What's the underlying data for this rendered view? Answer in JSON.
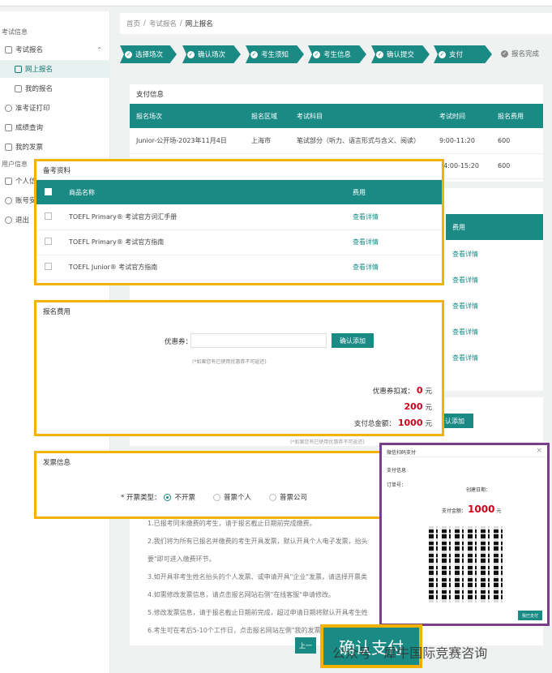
{
  "sidebar": {
    "group_exam": "考试信息",
    "exam_register": "考试报名",
    "online_register": "网上报名",
    "my_register": "我的报名",
    "admission_print": "准考证打印",
    "score_query": "成绩查询",
    "my_invoice": "我的发票",
    "group_user": "用户信息",
    "personal_info": "个人信",
    "account": "账号安",
    "logout": "退出"
  },
  "breadcrumb": {
    "home": "首页",
    "sep": "/",
    "exam_register": "考试报名",
    "current": "网上报名"
  },
  "steps": [
    "选择场次",
    "确认场次",
    "考生须知",
    "考生信息",
    "确认提交",
    "支付"
  ],
  "step_last": "报名完成",
  "check_mark": "✓",
  "payment_info": {
    "title": "支付信息",
    "headers": [
      "报名场次",
      "报名区域",
      "考试科目",
      "考试时间",
      "报名费用"
    ],
    "rows": [
      [
        "Junior-公开场-2023年11月4日",
        "上海市",
        "笔试部分（听力、语言形式与含义、阅读）",
        "9:00-11:20",
        "600"
      ],
      [
        "",
        "",
        "",
        "14:00-15:20",
        "600"
      ]
    ]
  },
  "materials": {
    "title": "备考资料",
    "headers": [
      "商品名称",
      "费用"
    ],
    "rows": [
      {
        "name": "TOEFL Primary® 考试官方词汇手册",
        "action": "查看详情"
      },
      {
        "name": "TOEFL Primary® 考试官方指南",
        "action": "查看详情"
      },
      {
        "name": "TOEFL Junior® 考试官方指南",
        "action": "查看详情"
      }
    ]
  },
  "behind_table": {
    "header": "费用",
    "links": [
      "查看详情",
      "查看详情",
      "查看详情",
      "查看详情",
      "查看详情"
    ],
    "add_btn": "认添加",
    "note": "(*如果您有已使用优惠券不可返还)"
  },
  "fees": {
    "title": "报名费用",
    "coupon_label": "优惠券：",
    "coupon_value": "",
    "add_button": "确认添加",
    "note": "(*如果您有已使用优惠券不可返还)",
    "discount_label": "优惠券扣减：",
    "discount_value": "0",
    "unit": "元",
    "material_value": "200",
    "total_label": "支付总金额：",
    "total_value": "1000"
  },
  "invoice": {
    "title": "发票信息",
    "type_label": "* 开票类型：",
    "options": [
      "不开票",
      "普票个人",
      "普票公司"
    ]
  },
  "notes": [
    "1.已报考同未缴费的考生，请于报名截止日期前完成缴费。",
    "2.我们将为所有已报名并缴费的考生开具发票，默认开具个人电子发票，抬头",
    "要\"即可进入缴费环节。",
    "3.如开具非考生姓名抬头的个人发票、或申请开具\"企业\"发票，请选择开票类",
    "4.如需修改发票信息，请点击报名网站右侧\"在线客服\"申请修改。",
    "5.修改发票信息，请于报名截止日期前完成，超过申请日期将默认开具考生姓",
    "6.考生可在考后5-10个工作日，点击报名网站左侧\"我的发票\"中下载发票。"
  ],
  "pay_dialog": {
    "title": "微信扫码支付",
    "close": "×",
    "section": "支付信息",
    "order_label": "订单号：",
    "order_value": "",
    "date_label": "创建日期：",
    "date_value": "",
    "amount_label": "支付金额：",
    "amount_value": "1000",
    "unit": "元",
    "done_button": "我已支付"
  },
  "confirm_pay": "确认支付",
  "prev_button": "上一",
  "watermark": "公众号 · 犀牛国际竞赛咨询"
}
